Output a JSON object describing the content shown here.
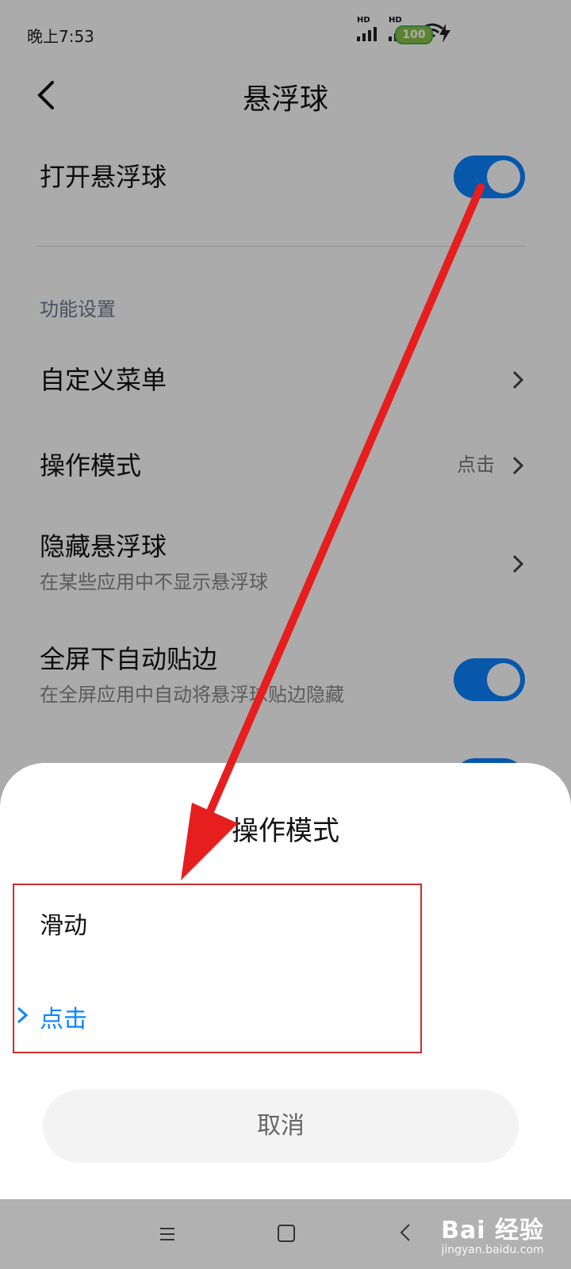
{
  "status": {
    "time": "晚上7:53",
    "battery": "100",
    "sim1": "HD",
    "sim2": "HD"
  },
  "header": {
    "title": "悬浮球"
  },
  "settings": {
    "open_ball": "打开悬浮球",
    "section_title": "功能设置",
    "custom_menu": "自定义菜单",
    "operation_mode": "操作模式",
    "operation_mode_value": "点击",
    "hide_ball": "隐藏悬浮球",
    "hide_ball_sub": "在某些应用中不显示悬浮球",
    "fullscreen_edge": "全屏下自动贴边",
    "fullscreen_edge_sub": "在全屏应用中自动将悬浮球贴边隐藏"
  },
  "sheet": {
    "title": "操作模式",
    "options": [
      "滑动",
      "点击"
    ],
    "selected": "点击",
    "cancel": "取消"
  },
  "watermark": {
    "main": "Bai 经验",
    "sub": "jingyan.baidu.com"
  },
  "colors": {
    "accent": "#0b84ff",
    "annotation": "#e61e1e"
  }
}
